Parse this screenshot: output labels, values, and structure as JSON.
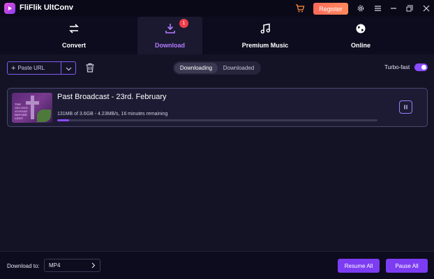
{
  "app": {
    "title": "FliFlik UltConv",
    "register_label": "Register"
  },
  "icons": {
    "logo": "app-logo-icon",
    "cart": "cart-icon",
    "settings": "gear-icon",
    "menu": "hamburger-menu-icon",
    "minimize": "minimize-icon",
    "maximize": "maximize-icon",
    "close": "close-icon"
  },
  "nav": {
    "tabs": [
      {
        "label": "Convert",
        "icon": "convert-arrows-icon"
      },
      {
        "label": "Download",
        "icon": "download-icon",
        "badge": "1",
        "active": true
      },
      {
        "label": "Premium Music",
        "icon": "music-note-icon"
      },
      {
        "label": "Online",
        "icon": "globe-icon"
      }
    ]
  },
  "toolbar": {
    "paste_url_label": "Paste URL",
    "segments": [
      "Downloading",
      "Downloaded"
    ],
    "active_segment": "Downloading",
    "turbo_label": "Turbo-fast",
    "turbo_enabled": true
  },
  "downloads": [
    {
      "title": "Past Broadcast - 23rd. February",
      "thumb_text": [
        "THE",
        "SECOND",
        "SUNDAY",
        "BEFORE",
        "LENT"
      ],
      "progress_text": "131MB of 3.6GB -   4.23MB/s, 16 minutes remaining",
      "progress_fraction": 0.036
    }
  ],
  "footer": {
    "download_to_label": "Download to:",
    "format_value": "MP4",
    "resume_all_label": "Resume All",
    "pause_all_label": "Pause All"
  },
  "colors": {
    "accent": "#8a4cff",
    "register": "#ff6a5a",
    "badge": "#ef3e4a",
    "background": "#0d0c1e"
  }
}
